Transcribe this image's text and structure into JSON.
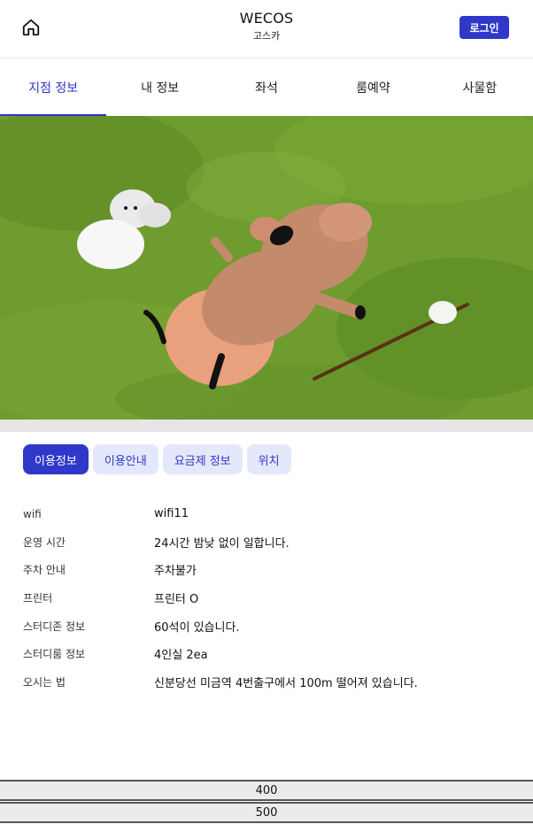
{
  "header": {
    "title": "WECOS",
    "subtitle": "고스카",
    "login_label": "로그인"
  },
  "tabs": [
    {
      "label": "지점 정보",
      "active": true
    },
    {
      "label": "내 정보",
      "active": false
    },
    {
      "label": "좌석",
      "active": false
    },
    {
      "label": "룸예약",
      "active": false
    },
    {
      "label": "사물함",
      "active": false
    }
  ],
  "info_tabs": [
    {
      "label": "이용정보",
      "active": true
    },
    {
      "label": "이용안내",
      "active": false
    },
    {
      "label": "요금제 정보",
      "active": false
    },
    {
      "label": "위치",
      "active": false
    }
  ],
  "info_rows": [
    {
      "label": "wifi",
      "value": "wifi11"
    },
    {
      "label": "운영 시간",
      "value": "24시간 밤낮 없이 일합니다."
    },
    {
      "label": "주차 안내",
      "value": "주차불가"
    },
    {
      "label": "프린터",
      "value": "프린터 O"
    },
    {
      "label": "스터디존 정보",
      "value": "60석이 있습니다."
    },
    {
      "label": "스터디룸 정보",
      "value": "4인실 2ea"
    },
    {
      "label": "오시는 법",
      "value": "신분당선 미금역 4번출구에서 100m 떨어져 있습니다."
    }
  ],
  "bottom_bars": [
    {
      "label": "400"
    },
    {
      "label": "500"
    }
  ],
  "icons": {
    "home": "home-icon"
  },
  "colors": {
    "accent": "#2f38c8",
    "chip_bg": "#e4e8fb",
    "grass": "#6d9b2c",
    "quokka": "#e9a07c"
  }
}
